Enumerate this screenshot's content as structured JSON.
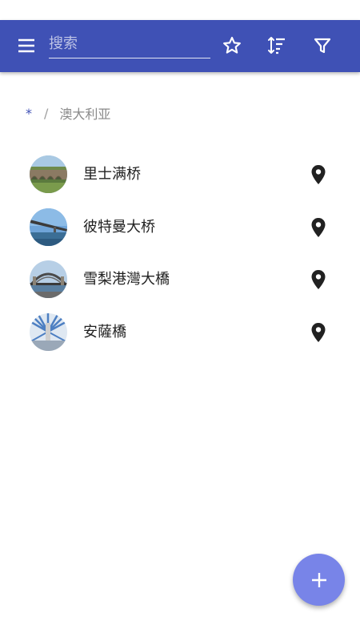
{
  "toolbar": {
    "menu_icon": "menu-icon",
    "search_placeholder": "搜索",
    "search_value": "",
    "star_icon": "star-outline-icon",
    "sort_icon": "sort-icon",
    "filter_icon": "filter-icon",
    "color": "#3f51b5"
  },
  "breadcrumb": {
    "root": "*",
    "separator": "/",
    "current": "澳大利亚"
  },
  "items": [
    {
      "title": "里士满桥",
      "thumbnail": "stone-arch-bridge-photo",
      "action_icon": "map-pin-icon"
    },
    {
      "title": "彼特曼大桥",
      "thumbnail": "pyrmont-bridge-photo",
      "action_icon": "map-pin-icon"
    },
    {
      "title": "雪梨港灣大橋",
      "thumbnail": "harbour-bridge-photo",
      "action_icon": "map-pin-icon"
    },
    {
      "title": "安薩橋",
      "thumbnail": "anzac-bridge-photo",
      "action_icon": "map-pin-icon"
    }
  ],
  "fab": {
    "icon": "plus-icon",
    "color": "#7884e8"
  }
}
